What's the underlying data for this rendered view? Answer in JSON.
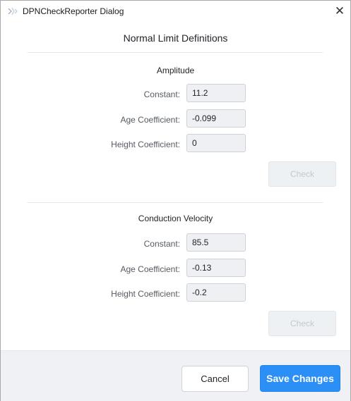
{
  "window": {
    "title": "DPNCheckReporter Dialog",
    "close_glyph": "✕",
    "app_icon": "app-logo-icon"
  },
  "main": {
    "title": "Normal Limit Definitions"
  },
  "amplitude": {
    "title": "Amplitude",
    "constant_label": "Constant:",
    "constant_value": "11.2",
    "age_label": "Age Coefficient:",
    "age_value": "-0.099",
    "height_label": "Height Coefficient:",
    "height_value": "0",
    "check_label": "Check"
  },
  "conduction": {
    "title": "Conduction Velocity",
    "constant_label": "Constant:",
    "constant_value": "85.5",
    "age_label": "Age Coefficient:",
    "age_value": "-0.13",
    "height_label": "Height Coefficient:",
    "height_value": "-0.2",
    "check_label": "Check"
  },
  "footer": {
    "cancel_label": "Cancel",
    "save_label": "Save Changes"
  },
  "colors": {
    "primary": "#2b8ff5",
    "footer_bg": "#eff1f4",
    "input_bg": "#eef0f3",
    "disabled_text": "#c3c8cd"
  }
}
